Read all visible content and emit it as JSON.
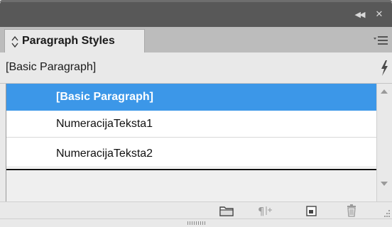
{
  "panel": {
    "tab_label": "Paragraph Styles",
    "current_style": "[Basic Paragraph]"
  },
  "styles": [
    {
      "label": "[Basic Paragraph]",
      "selected": true
    },
    {
      "label": "NumeracijaTeksta1",
      "selected": false
    },
    {
      "label": "NumeracijaTeksta2",
      "selected": false
    }
  ],
  "colors": {
    "selection": "#3c97e8",
    "titlebar": "#585858"
  },
  "icons": {
    "titlebar": [
      "collapse-panel-icon",
      "close-icon"
    ],
    "tab": [
      "up-down-arrows-icon"
    ],
    "menu": [
      "panel-menu-icon"
    ],
    "current": [
      "lightning-icon"
    ],
    "toolbar": [
      "folder-icon",
      "paragraph-override-icon",
      "new-style-icon",
      "trash-icon"
    ]
  }
}
